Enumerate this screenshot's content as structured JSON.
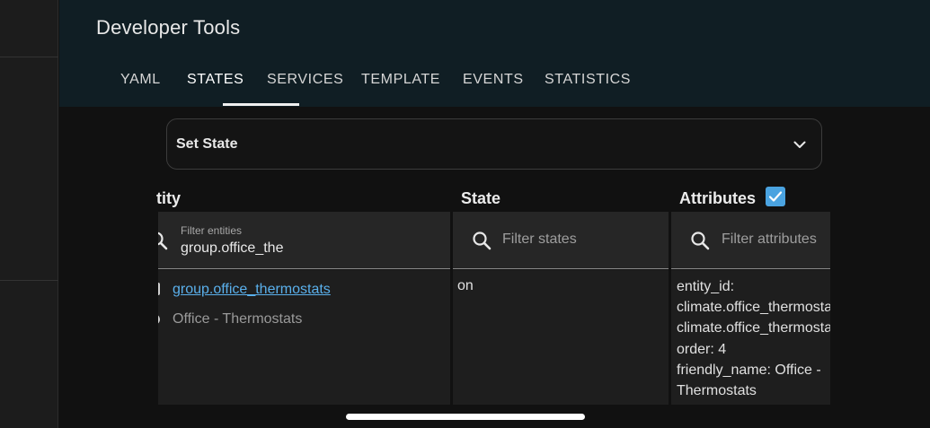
{
  "header": {
    "title": "Developer Tools",
    "tabs": [
      {
        "label": "YAML"
      },
      {
        "label": "STATES"
      },
      {
        "label": "SERVICES"
      },
      {
        "label": "TEMPLATE"
      },
      {
        "label": "EVENTS"
      },
      {
        "label": "STATISTICS"
      }
    ],
    "active_tab": "STATES"
  },
  "set_state": {
    "label": "Set State",
    "icon": "chevron-down-icon"
  },
  "table": {
    "headers": {
      "entity": "tity",
      "state": "State",
      "attributes": "Attributes"
    },
    "attributes_checkbox_checked": true,
    "filters": {
      "entity_label": "Filter entities",
      "entity_value": "group.office_the",
      "state_placeholder": "Filter states",
      "attributes_placeholder": "Filter attributes"
    },
    "row": {
      "entity_id": "group.office_thermostats",
      "friendly_name": "Office - Thermostats",
      "state": "on",
      "attributes": [
        "entity_id:",
        "climate.office_thermostat",
        "climate.office_thermostat",
        "order: 4",
        "friendly_name: Office -",
        "Thermostats"
      ]
    }
  },
  "colors": {
    "header_bg": "#101e24",
    "accent": "#4aa3e0",
    "link": "#5ab0ec",
    "background": "#111111"
  }
}
